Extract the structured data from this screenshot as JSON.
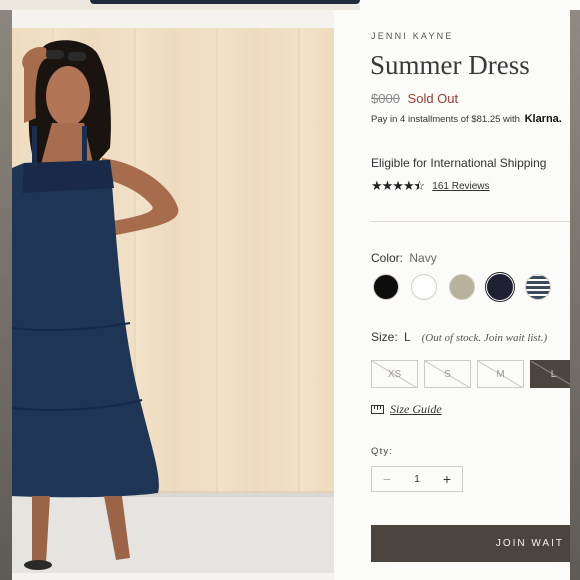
{
  "product": {
    "brand": "JENNI KAYNE",
    "title": "Summer Dress",
    "price_original": "$000",
    "status": "Sold Out",
    "installments_text": "Pay in 4 installments of $81.25 with",
    "klarna_logo": "Klarna.",
    "shipping_text": "Eligible for International Shipping",
    "rating_stars": 4.5,
    "reviews_link": "161 Reviews"
  },
  "color": {
    "label": "Color:",
    "selected": "Navy",
    "swatches": [
      {
        "name": "black",
        "color": "#0d0d0d"
      },
      {
        "name": "white",
        "color": "#ffffff"
      },
      {
        "name": "sage",
        "color": "#b7b29c"
      },
      {
        "name": "navy",
        "color": "#1f2033"
      },
      {
        "name": "stripe",
        "color": "#3b4a5c"
      }
    ]
  },
  "size": {
    "label": "Size:",
    "selected": "L",
    "note": "(Out of stock. Join wait list.)",
    "options": [
      "XS",
      "S",
      "M",
      "L"
    ],
    "guide_label": "Size Guide"
  },
  "quantity": {
    "label": "Qty:",
    "value": "1",
    "minus": "−",
    "plus": "+"
  },
  "cta": {
    "label": "JOIN WAIT"
  },
  "colors": {
    "accent_dark": "#4b4540",
    "sold_out": "#9a3b2c"
  }
}
